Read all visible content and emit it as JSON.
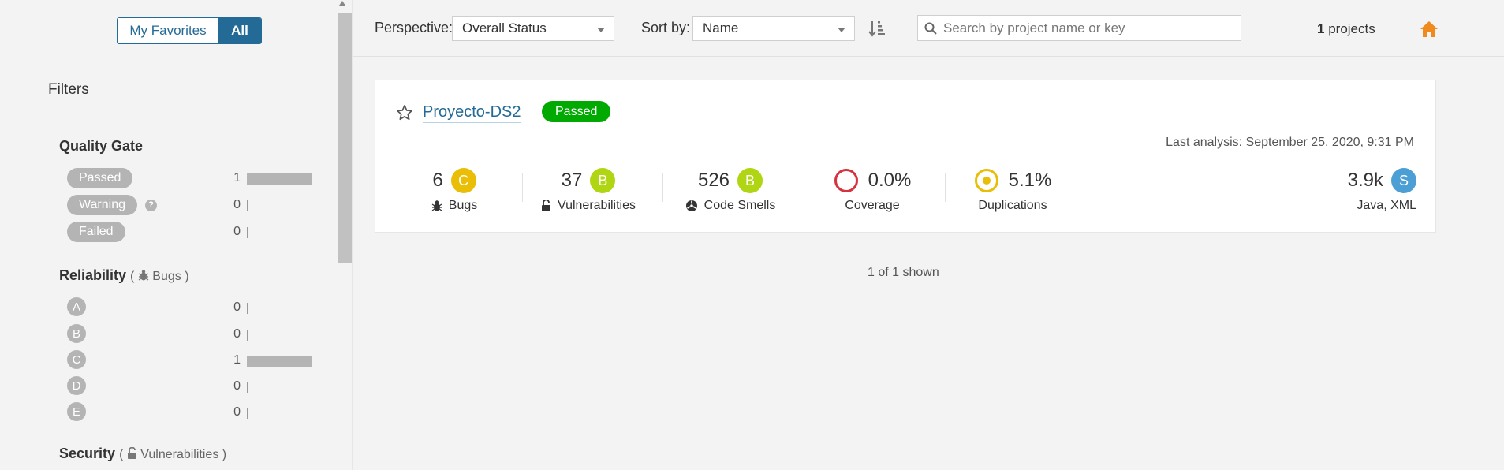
{
  "sidebar": {
    "view_toggle": {
      "favorites_label": "My Favorites",
      "all_label": "All"
    },
    "filters_title": "Filters",
    "quality_gate": {
      "title": "Quality Gate",
      "items": [
        {
          "label": "Passed",
          "count": "1",
          "fraction": 1.0
        },
        {
          "label": "Warning",
          "count": "0",
          "fraction": 0,
          "help": "?"
        },
        {
          "label": "Failed",
          "count": "0",
          "fraction": 0
        }
      ]
    },
    "reliability": {
      "title": "Reliability",
      "subtitle": "Bugs",
      "items": [
        {
          "label": "A",
          "count": "0",
          "fraction": 0
        },
        {
          "label": "B",
          "count": "0",
          "fraction": 0
        },
        {
          "label": "C",
          "count": "1",
          "fraction": 1.0
        },
        {
          "label": "D",
          "count": "0",
          "fraction": 0
        },
        {
          "label": "E",
          "count": "0",
          "fraction": 0
        }
      ]
    },
    "security": {
      "title": "Security",
      "subtitle": "Vulnerabilities"
    }
  },
  "topbar": {
    "perspective_label": "Perspective:",
    "perspective_value": "Overall Status",
    "sort_label": "Sort by:",
    "sort_value": "Name",
    "search_placeholder": "Search by project name or key",
    "projects_count": "1",
    "projects_suffix": "projects"
  },
  "project": {
    "name": "Proyecto-DS2",
    "status": "Passed",
    "last_analysis": "Last analysis: September 25, 2020, 9:31 PM",
    "measures": {
      "bugs": {
        "value": "6",
        "rating": "C",
        "label": "Bugs"
      },
      "vulnerabilities": {
        "value": "37",
        "rating": "B",
        "label": "Vulnerabilities"
      },
      "code_smells": {
        "value": "526",
        "rating": "B",
        "label": "Code Smells"
      },
      "coverage": {
        "value": "0.0%",
        "label": "Coverage"
      },
      "duplications": {
        "value": "5.1%",
        "label": "Duplications"
      },
      "size": {
        "value": "3.9k",
        "rating": "S",
        "label": "Java, XML"
      }
    }
  },
  "footer": {
    "shown_text": "1 of 1 shown"
  },
  "colors": {
    "accent": "#236a97",
    "passed": "#00aa00",
    "rating_c": "#eabe06",
    "rating_b": "#b0d513",
    "coverage_ring": "#d4333f",
    "duplication_ring": "#eabe06",
    "size_badge": "#4b9fd5",
    "home": "#f18a1c"
  }
}
